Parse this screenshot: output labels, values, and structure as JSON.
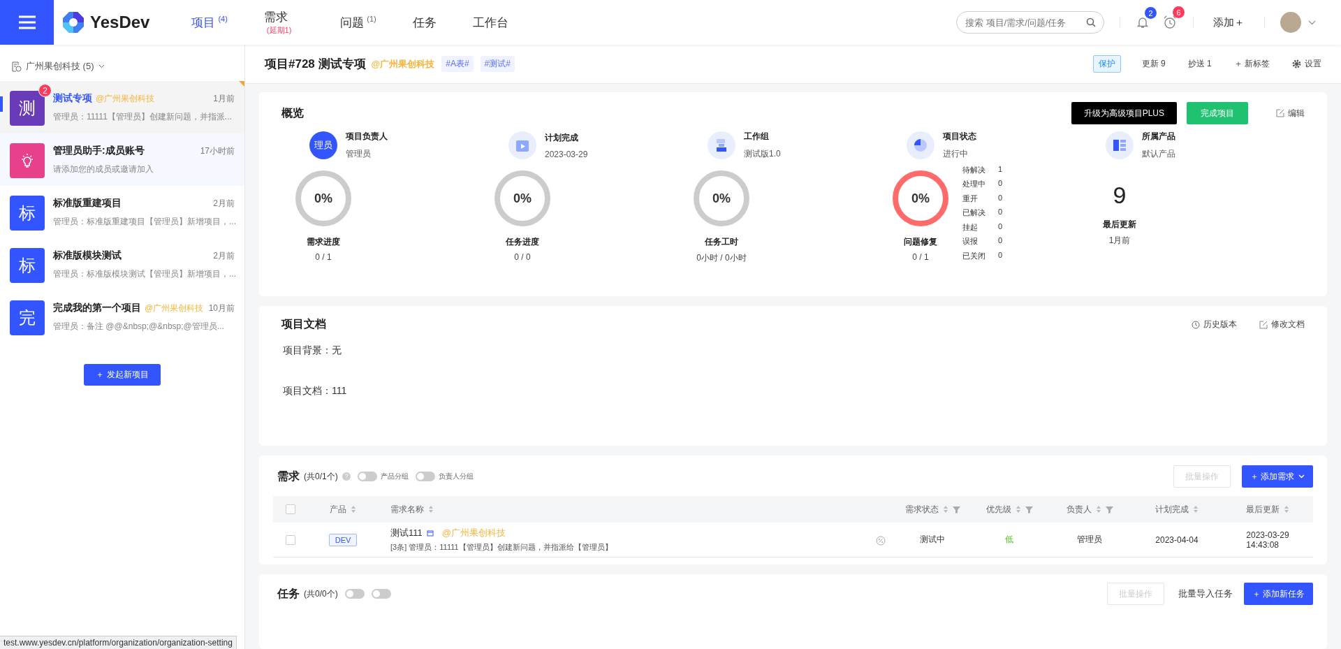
{
  "nav": {
    "brand": "YesDev",
    "tabs": [
      {
        "label": "项目",
        "count": "(4)",
        "selected": true,
        "alert": false
      },
      {
        "label": "需求",
        "count": "(延期1)",
        "selected": false,
        "alert": true
      },
      {
        "label": "问题",
        "count": "(1)",
        "selected": false,
        "alert": false
      },
      {
        "label": "任务",
        "selected": false
      },
      {
        "label": "工作台",
        "selected": false
      }
    ],
    "search": {
      "placeholder": "搜索 项目/需求/问题/任务"
    },
    "alerts": [
      {
        "kind": "bell",
        "badge": "2",
        "color": "#3355ff"
      },
      {
        "kind": "clock",
        "badge": "6",
        "color": "#ff3b5c"
      }
    ],
    "add": "添加＋"
  },
  "sidebar": {
    "org": "广州果创科技 (5)",
    "projects": [
      {
        "kind": "project",
        "avatar": "测",
        "color": "#6a3bb8",
        "badge": "2",
        "title": "测试专项",
        "org": "@广州果创科技",
        "time": "1月前",
        "summary": "管理员：11111【管理员】创建新问题，并指派...",
        "selected": true
      },
      {
        "kind": "assistant",
        "color": "#e8408a",
        "title": "管理员助手:成员账号",
        "time": "17小时前",
        "summary": "请添加您的成员或邀请加入",
        "selected": false
      },
      {
        "kind": "project",
        "avatar": "标",
        "color": "#3355ff",
        "title": "标准版重建项目",
        "time": "2月前",
        "summary": "管理员：标准版重建项目【管理员】新增项目，...",
        "selected": false
      },
      {
        "kind": "project",
        "avatar": "标",
        "color": "#3355ff",
        "title": "标准版模块测试",
        "time": "2月前",
        "summary": "管理员：标准版模块测试【管理员】新增项目，...",
        "selected": false
      },
      {
        "kind": "project",
        "avatar": "完",
        "color": "#3355ff",
        "title": "完成我的第一个项目",
        "org": "@广州果创科技",
        "time": "10月前",
        "summary": "管理员：备注 @@&nbsp;@&nbsp;@管理员...",
        "selected": false
      }
    ],
    "new_button": "＋ 发起新项目"
  },
  "header": {
    "title": "项目#728 测试专项",
    "org": "@广州果创科技",
    "tags": [
      "#A表#",
      "#测试#"
    ],
    "protect": "保护",
    "updates": "更新 9",
    "cc": "抄送 1",
    "new_tag": "＋ 新标签",
    "settings": "设置"
  },
  "overview": {
    "title": "概览",
    "upgrade": "升级为高级项目PLUS",
    "complete": "完成项目",
    "edit": "编辑",
    "info": [
      {
        "kind": "owner",
        "avatar": "理员",
        "label": "项目负责人",
        "value": "管理员"
      },
      {
        "kind": "plan",
        "label": "计划完成",
        "value": "2023-03-29"
      },
      {
        "kind": "group",
        "label": "工作组",
        "value": "测试版1.0"
      },
      {
        "kind": "status",
        "label": "项目状态",
        "value": "进行中"
      },
      {
        "kind": "product",
        "label": "所属产品",
        "value": "默认产品"
      }
    ],
    "rings": [
      {
        "value": "0%",
        "label": "需求进度",
        "sub": "0 / 1",
        "color": "#cccccc"
      },
      {
        "value": "0%",
        "label": "任务进度",
        "sub": "0 / 0",
        "color": "#cccccc"
      },
      {
        "value": "0%",
        "label": "任务工时",
        "sub": "0小时 / 0小时",
        "color": "#cccccc"
      },
      {
        "value": "0%",
        "label": "问题修复",
        "sub": "0 / 1",
        "color": "#ff6b6b"
      }
    ],
    "issue_stats": [
      {
        "label": "待解决",
        "value": "1"
      },
      {
        "label": "处理中",
        "value": "0"
      },
      {
        "label": "重开",
        "value": "0"
      },
      {
        "label": "已解决",
        "value": "0"
      },
      {
        "label": "挂起",
        "value": "0"
      },
      {
        "label": "误报",
        "value": "0"
      },
      {
        "label": "已关闭",
        "value": "0"
      }
    ],
    "updates": {
      "value": "9",
      "label": "最后更新",
      "sub": "1月前"
    }
  },
  "docs": {
    "title": "项目文档",
    "history": "历史版本",
    "modify": "修改文档",
    "lines": [
      "项目背景：无",
      "项目文档：111"
    ]
  },
  "requirements": {
    "title": "需求",
    "count": "(共0/1个)",
    "toggles": [
      {
        "label": "产品分组",
        "on": false
      },
      {
        "label": "负责人分组",
        "on": false
      }
    ],
    "batch": {
      "label": "批量操作",
      "disabled": true
    },
    "add": "＋ 添加需求",
    "select_all": {
      "checked": false
    },
    "columns": [
      {
        "label": "产品",
        "sortable": true,
        "filterable": false
      },
      {
        "label": "需求名称",
        "sortable": true,
        "filterable": false
      },
      {
        "label": "需求状态",
        "sortable": true,
        "filterable": true
      },
      {
        "label": "优先级",
        "sortable": true,
        "filterable": true
      },
      {
        "label": "负责人",
        "sortable": true,
        "filterable": true
      },
      {
        "label": "计划完成",
        "sortable": true,
        "filterable": false
      },
      {
        "label": "最后更新",
        "sortable": true,
        "filterable": false
      }
    ],
    "rows": [
      {
        "checked": false,
        "product": "DEV",
        "name": "测试111",
        "org": "@广州果创科技",
        "summary": "[3条] 管理员：11111【管理员】创建新问题，并指派给【管理员】",
        "status": "测试中",
        "priority": "低",
        "owner": "管理员",
        "plan": "2023-04-04",
        "updated": [
          "2023-03-29",
          "14:43:08"
        ]
      }
    ]
  },
  "tasks": {
    "title": "任务",
    "count": "(共0/0个)",
    "toggles": [
      {
        "on": false
      },
      {
        "on": false
      }
    ],
    "batch": {
      "label": "批量操作",
      "disabled": true
    },
    "import": "批量导入任务",
    "add": "＋ 添加新任务"
  },
  "status_bar": "test.www.yesdev.cn/platform/organization/organization-setting"
}
